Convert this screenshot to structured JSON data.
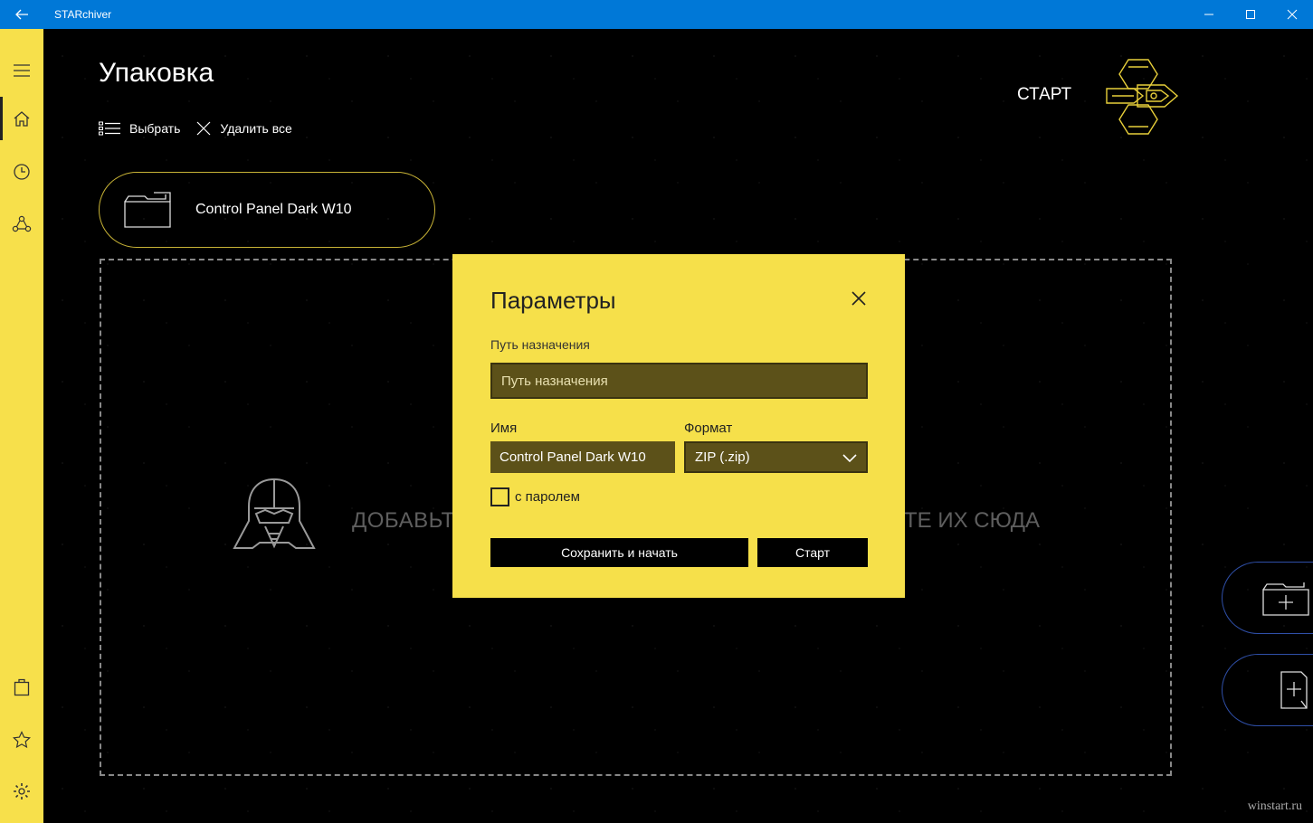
{
  "window": {
    "title": "STARchiver"
  },
  "colors": {
    "accent_yellow": "#f7e04b",
    "titlebar_blue": "#0078d7",
    "card_border": "#c9b436",
    "pill_border": "#2f4fa8"
  },
  "sidebar": {
    "items": [
      {
        "icon": "hamburger-menu-icon"
      },
      {
        "icon": "home-icon",
        "active": true
      },
      {
        "icon": "history-clock-icon"
      },
      {
        "icon": "share-icon"
      },
      {
        "icon": "shopping-bag-icon"
      },
      {
        "icon": "star-icon"
      },
      {
        "icon": "gear-icon"
      }
    ]
  },
  "main": {
    "title": "Упаковка",
    "toolbar": {
      "select_label": "Выбрать",
      "delete_all_label": "Удалить все"
    },
    "start_label": "СТАРТ",
    "file_card": {
      "name": "Control Panel Dark W10"
    },
    "drop_hint_left": "ДОБАВЬТЕ",
    "drop_hint_right": "ТЕ ИХ СЮДА"
  },
  "dialog": {
    "title": "Параметры",
    "destination_label": "Путь назначения",
    "destination_placeholder": "Путь назначения",
    "name_label": "Имя",
    "name_value": "Control Panel Dark W10",
    "format_label": "Формат",
    "format_value": "ZIP (.zip)",
    "password_label": "с паролем",
    "password_checked": false,
    "save_start_label": "Сохранить и начать",
    "start_label": "Старт"
  },
  "watermark": "winstart.ru"
}
